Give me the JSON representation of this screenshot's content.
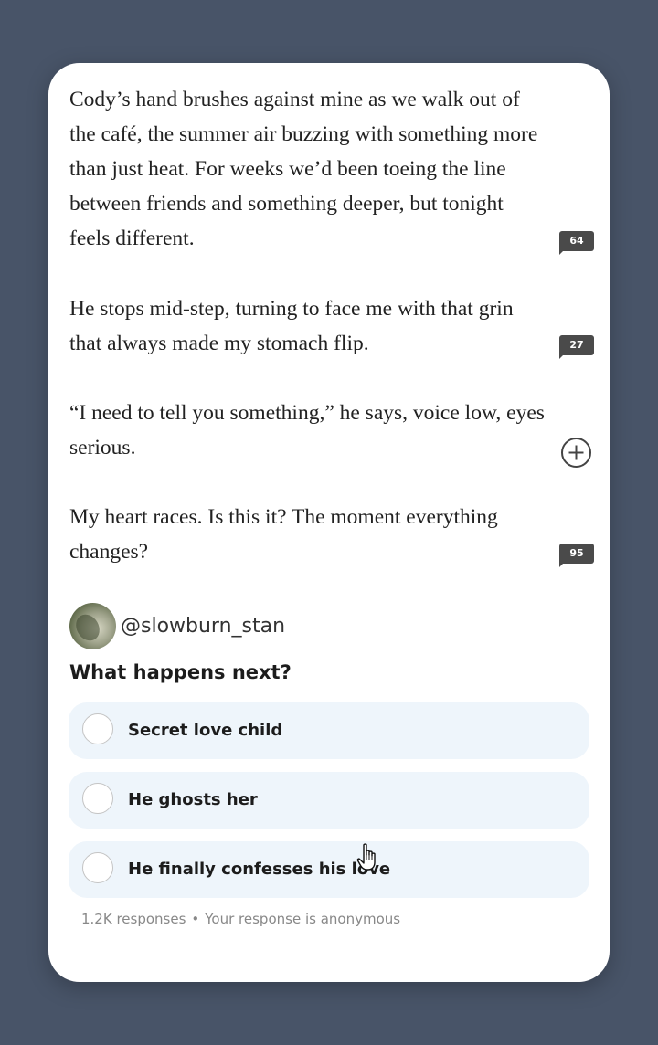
{
  "story": {
    "paragraphs": [
      "Cody’s hand brushes against mine as we walk out of the café, the summer air buzzing with something more than just heat. For weeks we’d been toeing the line between friends and something deeper, but tonight feels different.",
      "He stops mid-step, turning to face me with that grin that always made my stomach flip.",
      "“I need to tell you something,” he says, voice low, eyes serious.",
      "My heart races. Is this it? The moment everything changes?"
    ],
    "comment_counts": [
      "64",
      "27",
      "95"
    ],
    "add_comment_icon": "plus-circle-icon"
  },
  "poll": {
    "author": "@slowburn_stan",
    "question": "What happens next?",
    "options": [
      "Secret love child",
      "He ghosts her",
      "He finally confesses his love"
    ],
    "responses": "1.2K responses",
    "separator": "•",
    "anonymity_note": "Your response is anonymous"
  },
  "colors": {
    "background": "#485468",
    "card": "#ffffff",
    "badge": "#4a4a4a",
    "option_bg": "#eef5fb",
    "text": "#222222",
    "muted": "#888888"
  }
}
